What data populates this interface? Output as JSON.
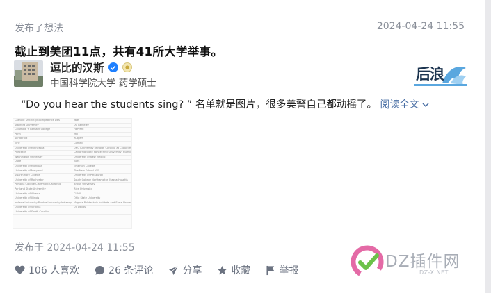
{
  "post": {
    "action_label": "发布了想法",
    "header_time": "2024-04-24 11:55",
    "title": "截止到美团11点，共有41所大学举事。",
    "author": {
      "name": "逗比的汉斯",
      "description": "中国科学院大学 药学硕士"
    },
    "badge_text": "后浪",
    "excerpt": "“Do you hear the students sing? ” 名单就是图片，很多美警自己都动摇了。",
    "read_more": "阅读全文",
    "image_rows": [
      [
        "Catholic District (incompetence was",
        "Yale"
      ],
      [
        "Stanford University",
        "UC Berkeley"
      ],
      [
        "Columbia + Barnard College",
        "Harvard"
      ],
      [
        "Penn",
        "MIT"
      ],
      [
        "Vanderbilt",
        "Rutgers"
      ],
      [
        "NYU",
        "Cornell"
      ],
      [
        "University of Minnesota",
        "UNC (University of North Carolina at Chapel Hill)"
      ],
      [
        "Princeton",
        "California State Polytechnic University, Humboldt"
      ],
      [
        "Washington University",
        "University of New Mexico"
      ],
      [
        "Duke",
        "Tufts"
      ],
      [
        "University of Michigan",
        "Emerson College"
      ],
      [
        "University of Maryland",
        "The New School NYC"
      ],
      [
        "Swarthmore College",
        "University of Pittsburgh"
      ],
      [
        "University of Rochester",
        "South College Northampton Massachusetts"
      ],
      [
        "Pomona College Claremont California",
        "Brown University"
      ],
      [
        "Portland State University",
        "Rice University"
      ],
      [
        "University of Alberta",
        "CUNY"
      ],
      [
        "University of Illinois",
        "Ohio State University"
      ],
      [
        "Indiana University-Purdue University Indianapolis (IUPUI)",
        "Virginia Polytechnic Institute and State University / Virginia Tech"
      ],
      [
        "University of Virginia",
        "UT Dallas"
      ],
      [
        "University of South Carolina",
        ""
      ]
    ],
    "post_time": "发布于 2024-04-24 11:55",
    "actions": {
      "like": "106 人喜欢",
      "comment": "26 条评论",
      "share": "分享",
      "favorite": "收藏",
      "report": "举报"
    }
  },
  "watermark": {
    "text": "DZ插件网",
    "sub": "DZ-X.NET"
  },
  "colors": {
    "muted": "#8a8f99",
    "link": "#4a6fa5",
    "verified": "#1e80ff"
  }
}
